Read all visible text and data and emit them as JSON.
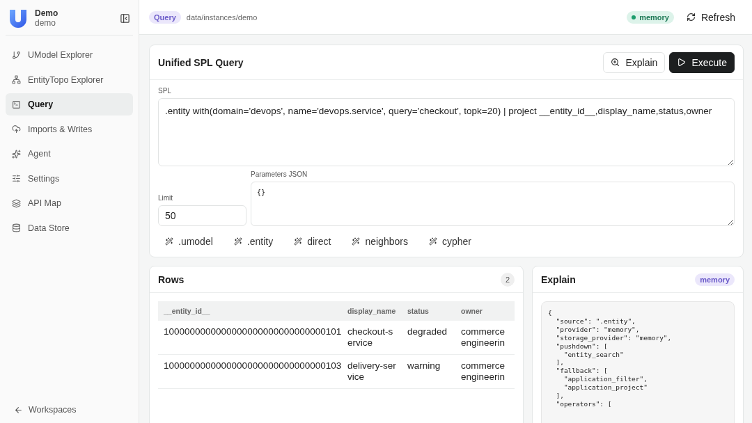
{
  "workspace": {
    "name": "Demo",
    "slug": "demo"
  },
  "sidebar": {
    "items": [
      {
        "label": "UModel Explorer",
        "selected": false
      },
      {
        "label": "EntityTopo Explorer",
        "selected": false
      },
      {
        "label": "Query",
        "selected": true
      },
      {
        "label": "Imports & Writes",
        "selected": false
      },
      {
        "label": "Agent",
        "selected": false
      },
      {
        "label": "Settings",
        "selected": false
      },
      {
        "label": "API Map",
        "selected": false
      },
      {
        "label": "Data Store",
        "selected": false
      }
    ],
    "footer": "Workspaces"
  },
  "header": {
    "page_badge": "Query",
    "path": "data/instances/demo",
    "status_badge": "memory",
    "refresh": "Refresh"
  },
  "query_card": {
    "title": "Unified SPL Query",
    "explain_button": "Explain",
    "execute_button": "Execute",
    "spl_label": "SPL",
    "spl_value": ".entity with(domain='devops', name='devops.service', query='checkout', topk=20) | project __entity_id__,display_name,status,owner",
    "limit_label": "Limit",
    "limit_value": "50",
    "params_label": "Parameters JSON",
    "params_value": "{}",
    "templates": [
      ".umodel",
      ".entity",
      "direct",
      "neighbors",
      "cypher"
    ]
  },
  "rows_card": {
    "title": "Rows",
    "count": "2",
    "columns": [
      "__entity_id__",
      "display_name",
      "status",
      "owner"
    ],
    "rows": [
      [
        "1000000000000000000000000000000101",
        "checkout-service",
        "degraded",
        "commerce engineerin"
      ],
      [
        "1000000000000000000000000000000103",
        "delivery-service",
        "warning",
        "commerce engineerin"
      ]
    ]
  },
  "explain_card": {
    "title": "Explain",
    "badge": "memory",
    "code_lines": [
      "{",
      "  \"source\": \".entity\",",
      "  \"provider\": \"memory\",",
      "  \"storage_provider\": \"memory\",",
      "  \"pushdown\": [",
      "    \"entity_search\"",
      "  ],",
      "  \"fallback\": [",
      "    \"application_filter\",",
      "    \"application_project\"",
      "  ],",
      "  \"operators\": ["
    ]
  }
}
